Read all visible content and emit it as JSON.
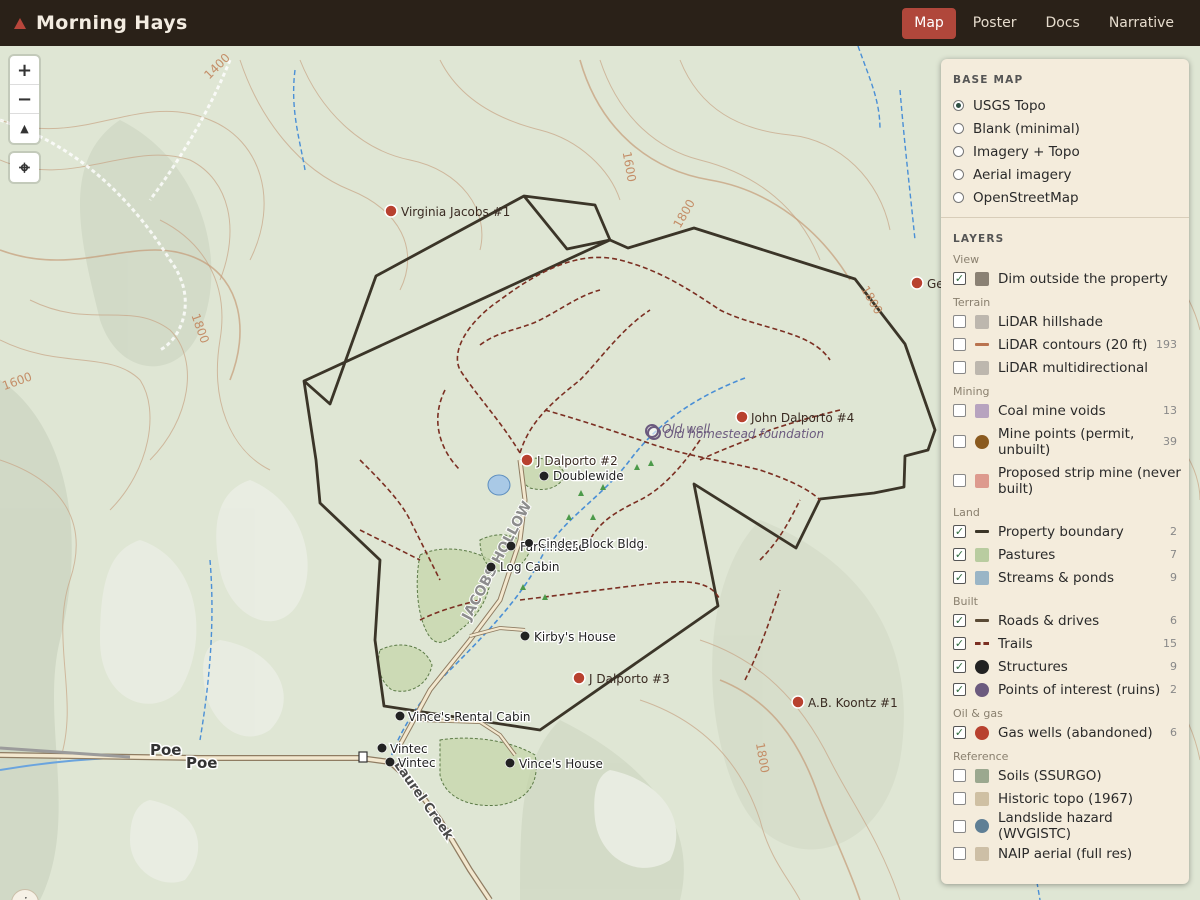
{
  "app": {
    "title": "Morning Hays"
  },
  "nav": {
    "tabs": [
      "Map",
      "Poster",
      "Docs",
      "Narrative"
    ],
    "active": "Map"
  },
  "controls": {
    "zoom_in": "+",
    "zoom_out": "−",
    "compass": "▲",
    "locate": "⌖",
    "info": "i"
  },
  "map": {
    "contour_labels": [
      "1400",
      "1600",
      "1800",
      "1600",
      "1800",
      "1800",
      "1800"
    ],
    "road_labels": [
      "Poe",
      "Poe",
      "JACOBS HOLLOW",
      "Laurel Creek"
    ],
    "gas_wells": [
      "Virginia Jacobs #1",
      "Ge",
      "J Dalporto #2",
      "John Dalporto #4",
      "J Dalporto #3",
      "A.B. Koontz #1"
    ],
    "structures": [
      "Doublewide",
      "Farmhouse",
      "Cinder Block Bldg.",
      "Log Cabin",
      "Kirby's House",
      "Vince's Rental Cabin",
      "Vintec",
      "Vintec",
      "Vince's House"
    ],
    "points_of_interest": [
      "Old well",
      "Old homestead foundation"
    ]
  },
  "panel": {
    "base_map": {
      "heading": "BASE MAP",
      "options": [
        "USGS Topo",
        "Blank (minimal)",
        "Imagery + Topo",
        "Aerial imagery",
        "OpenStreetMap"
      ],
      "selected": "USGS Topo"
    },
    "layers": {
      "heading": "LAYERS",
      "groups": [
        {
          "name": "View",
          "items": [
            {
              "label": "Dim outside the property",
              "checked": true,
              "count": "",
              "swatch": "#8a8174"
            }
          ]
        },
        {
          "name": "Terrain",
          "items": [
            {
              "label": "LiDAR hillshade",
              "checked": false,
              "count": "",
              "swatch": "#bdb7ae"
            },
            {
              "label": "LiDAR contours (20 ft)",
              "checked": false,
              "count": "193",
              "swatch": "#b9734f"
            },
            {
              "label": "LiDAR multidirectional",
              "checked": false,
              "count": "",
              "swatch": "#bdb7ae"
            }
          ]
        },
        {
          "name": "Mining",
          "items": [
            {
              "label": "Coal mine voids",
              "checked": false,
              "count": "13",
              "swatch": "#b7a3bf"
            },
            {
              "label": "Mine points (permit, unbuilt)",
              "checked": false,
              "count": "39",
              "swatch": "#8a5a1f"
            },
            {
              "label": "Proposed strip mine (never built)",
              "checked": false,
              "count": "",
              "swatch": "#dd9a8e"
            }
          ]
        },
        {
          "name": "Land",
          "items": [
            {
              "label": "Property boundary",
              "checked": true,
              "count": "2",
              "swatch": "#3b3528"
            },
            {
              "label": "Pastures",
              "checked": true,
              "count": "7",
              "swatch": "#b9cca0"
            },
            {
              "label": "Streams & ponds",
              "checked": true,
              "count": "9",
              "swatch": "#9ab5c6"
            }
          ]
        },
        {
          "name": "Built",
          "items": [
            {
              "label": "Roads & drives",
              "checked": true,
              "count": "6",
              "swatch": "#5a4a35"
            },
            {
              "label": "Trails",
              "checked": true,
              "count": "15",
              "swatch": "#7b2f22"
            },
            {
              "label": "Structures",
              "checked": true,
              "count": "9",
              "swatch": "#222222"
            },
            {
              "label": "Points of interest (ruins)",
              "checked": true,
              "count": "2",
              "swatch": "#6b5a7e"
            }
          ]
        },
        {
          "name": "Oil & gas",
          "items": [
            {
              "label": "Gas wells (abandoned)",
              "checked": true,
              "count": "6",
              "swatch": "#b8412f"
            }
          ]
        },
        {
          "name": "Reference",
          "items": [
            {
              "label": "Soils (SSURGO)",
              "checked": false,
              "count": "",
              "swatch": "#9ba88f"
            },
            {
              "label": "Historic topo (1967)",
              "checked": false,
              "count": "",
              "swatch": "#cfc0a3"
            },
            {
              "label": "Landslide hazard (WVGISTC)",
              "checked": false,
              "count": "",
              "swatch": "#5f7f95"
            },
            {
              "label": "NAIP aerial (full res)",
              "checked": false,
              "count": "",
              "swatch": "#cdbfa6"
            }
          ]
        }
      ]
    }
  },
  "colors": {
    "topbar": "#2a2118",
    "accent": "#b0473b",
    "panel": "#f4ecdc",
    "boundary": "#3b3528",
    "trail": "#7b2f22",
    "well": "#b8412f",
    "contour": "#c9a88a",
    "stream": "#4a8fd6"
  }
}
